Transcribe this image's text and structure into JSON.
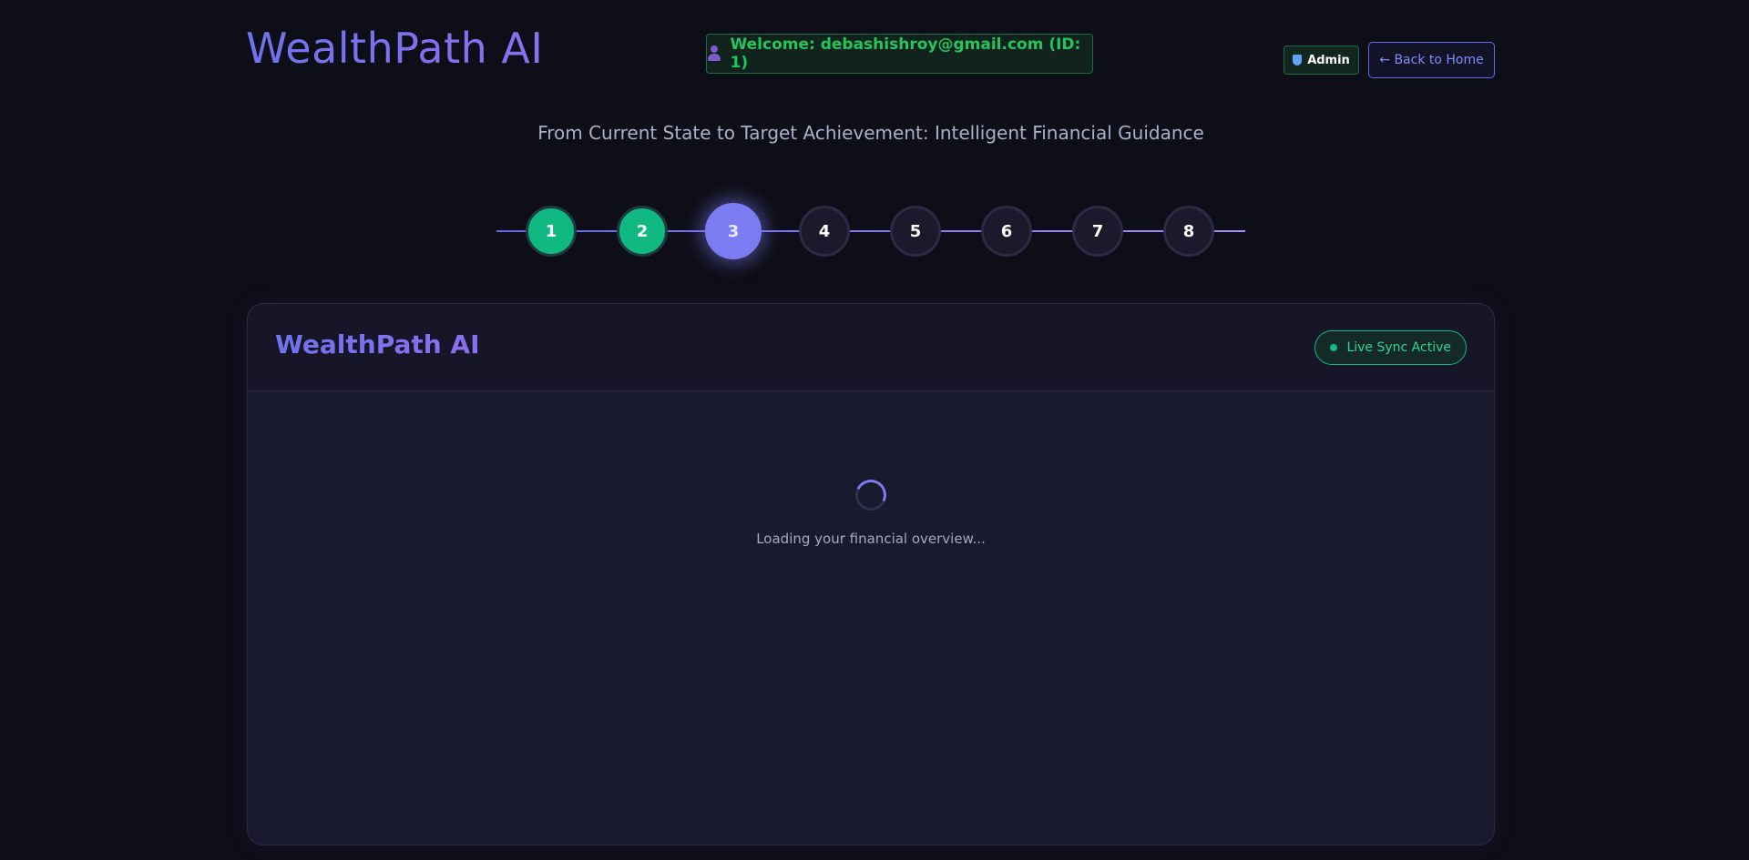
{
  "header": {
    "brand": "WealthPath AI",
    "welcome_text": "Welcome: debashishroy@gmail.com (ID: 1)",
    "user_icon": "user-icon",
    "admin_label": "Admin",
    "admin_icon": "shield-icon",
    "back_label": "← Back to Home"
  },
  "subtitle": "From Current State to Target Achievement: Intelligent Financial Guidance",
  "stepper": {
    "current_step": 3,
    "steps": [
      {
        "label": "1",
        "status": "completed"
      },
      {
        "label": "2",
        "status": "completed"
      },
      {
        "label": "3",
        "status": "active"
      },
      {
        "label": "4",
        "status": "pending"
      },
      {
        "label": "5",
        "status": "pending"
      },
      {
        "label": "6",
        "status": "pending"
      },
      {
        "label": "7",
        "status": "pending"
      },
      {
        "label": "8",
        "status": "pending"
      }
    ]
  },
  "card": {
    "title": "WealthPath AI",
    "sync_label": "Live Sync Active",
    "loading_text": "Loading your financial overview..."
  },
  "colors": {
    "background": "#0e0e18",
    "accent": "#7c7cf2",
    "success": "#10b981",
    "card": "#1a1a2e"
  }
}
